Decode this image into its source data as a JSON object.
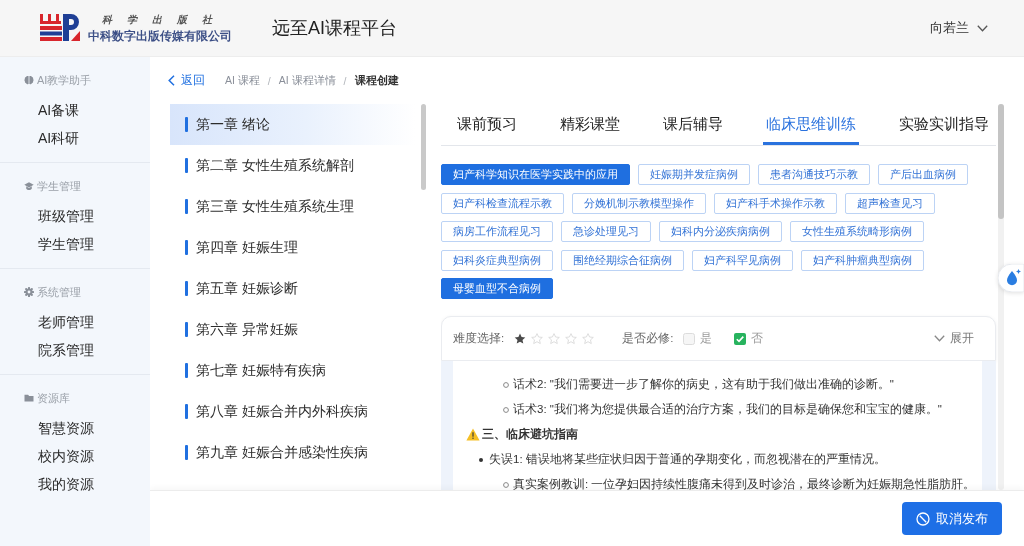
{
  "header": {
    "logo_lines": [
      "科学出版社",
      "中科数字出版传媒有限公司"
    ],
    "title": "远至AI课程平台",
    "user": "向若兰"
  },
  "sidebar": {
    "sections": [
      {
        "kind": "ai",
        "title": "AI教学助手",
        "items": [
          "AI备课",
          "AI科研"
        ]
      },
      {
        "kind": "student",
        "title": "学生管理",
        "items": [
          "班级管理",
          "学生管理"
        ]
      },
      {
        "kind": "system",
        "title": "系统管理",
        "items": [
          "老师管理",
          "院系管理"
        ]
      },
      {
        "kind": "resource",
        "title": "资源库",
        "items": [
          "智慧资源",
          "校内资源",
          "我的资源"
        ]
      }
    ]
  },
  "breadcrumb": {
    "back": "返回",
    "separator": "/",
    "items": [
      {
        "label": "AI 课程",
        "current": false
      },
      {
        "label": "AI 课程详情",
        "current": false
      },
      {
        "label": "课程创建",
        "current": true
      }
    ]
  },
  "chapters": [
    {
      "label": "第一章 绪论",
      "selected": true
    },
    {
      "label": "第二章 女性生殖系统解剖",
      "selected": false
    },
    {
      "label": "第三章 女性生殖系统生理",
      "selected": false
    },
    {
      "label": "第四章 妊娠生理",
      "selected": false
    },
    {
      "label": "第五章 妊娠诊断",
      "selected": false
    },
    {
      "label": "第六章 异常妊娠",
      "selected": false
    },
    {
      "label": "第七章 妊娠特有疾病",
      "selected": false
    },
    {
      "label": "第八章 妊娠合并内外科疾病",
      "selected": false
    },
    {
      "label": "第九章 妊娠合并感染性疾病",
      "selected": false
    }
  ],
  "panel": {
    "tabs": [
      {
        "label": "课前预习",
        "selected": false
      },
      {
        "label": "精彩课堂",
        "selected": false
      },
      {
        "label": "课后辅导",
        "selected": false
      },
      {
        "label": "临床思维训练",
        "selected": true
      },
      {
        "label": "实验实训指导",
        "selected": false
      }
    ],
    "tags": [
      {
        "label": "妇产科学知识在医学实践中的应用",
        "selected": true
      },
      {
        "label": "妊娠期并发症病例",
        "selected": false
      },
      {
        "label": "患者沟通技巧示教",
        "selected": false
      },
      {
        "label": "产后出血病例",
        "selected": false
      },
      {
        "label": "妇产科检查流程示教",
        "selected": false
      },
      {
        "label": "分娩机制示教模型操作",
        "selected": false
      },
      {
        "label": "妇产科手术操作示教",
        "selected": false
      },
      {
        "label": "超声检查见习",
        "selected": false
      },
      {
        "label": "病房工作流程见习",
        "selected": false
      },
      {
        "label": "急诊处理见习",
        "selected": false
      },
      {
        "label": "妇科内分泌疾病病例",
        "selected": false
      },
      {
        "label": "女性生殖系统畸形病例",
        "selected": false
      },
      {
        "label": "妇科炎症典型病例",
        "selected": false
      },
      {
        "label": "围绝经期综合征病例",
        "selected": false
      },
      {
        "label": "妇产科罕见病例",
        "selected": false
      },
      {
        "label": "妇产科肿瘤典型病例",
        "selected": false
      },
      {
        "label": "母婴血型不合病例",
        "selected": true
      }
    ],
    "filter": {
      "difficulty_label": "难度选择:",
      "stars": 1,
      "required_label": "是否必修:",
      "required_options": [
        {
          "label": "是",
          "checked": false
        },
        {
          "label": "否",
          "checked": true
        }
      ],
      "expand": "展开"
    },
    "content": [
      {
        "kind": "sub_item",
        "text": "话术2: \"我们需要进一步了解你的病史，这有助于我们做出准确的诊断。\""
      },
      {
        "kind": "sub_item",
        "text": "话术3: \"我们将为您提供最合适的治疗方案，我们的目标是确保您和宝宝的健康。\""
      },
      {
        "kind": "heading",
        "text": "三、临床避坑指南"
      },
      {
        "kind": "item",
        "text": "失误1: 错误地将某些症状归因于普通的孕期变化，而忽视潜在的严重情况。"
      },
      {
        "kind": "sub_item",
        "text": "真实案例教训: 一位孕妇因持续性腹痛未得到及时诊治，最终诊断为妊娠期急性脂肪肝。"
      }
    ]
  },
  "footer": {
    "button": "取消发布"
  }
}
